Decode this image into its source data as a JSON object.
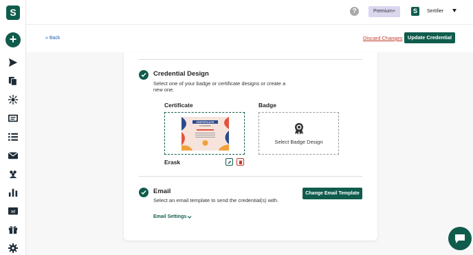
{
  "app": {
    "logo_letter": "S",
    "user_logo_letter": "S",
    "help_label": "?",
    "add_label": "+",
    "premium_label": "Premium+",
    "user_name": "Sertifier"
  },
  "colors": {
    "brand": "#0f5c4c",
    "danger": "#c0392b",
    "link": "#1a5fb4",
    "premium_bg": "#d9d6ee"
  },
  "sidebar": {
    "items": [
      {
        "icon": "send-icon"
      },
      {
        "icon": "copy-icon"
      },
      {
        "icon": "integration-icon"
      },
      {
        "icon": "certificate-icon"
      },
      {
        "icon": "list-icon"
      },
      {
        "icon": "mail-icon"
      },
      {
        "icon": "users-icon"
      },
      {
        "icon": "chart-icon"
      },
      {
        "icon": "ad-icon",
        "label": "ad"
      },
      {
        "icon": "gift-icon"
      },
      {
        "icon": "settings-icon"
      }
    ]
  },
  "subheader": {
    "back": "« Back",
    "discard": "Discard Changes",
    "update": "Update Credential"
  },
  "design": {
    "title": "Credential Design",
    "description": "Select one of your badge or certificate designs or create a new one.",
    "certificate_label": "Certificate",
    "badge_label": "Badge",
    "select_badge": "Select Badge Design",
    "certificate_name": "Erask",
    "thumb_title": "CERTIFICATE",
    "thumb_subtitle": "ACHIEVEMENT"
  },
  "email": {
    "title": "Email",
    "description": "Select an email template to send the credential(s) with.",
    "change_template": "Change Email Template",
    "settings": "Email Settings"
  }
}
